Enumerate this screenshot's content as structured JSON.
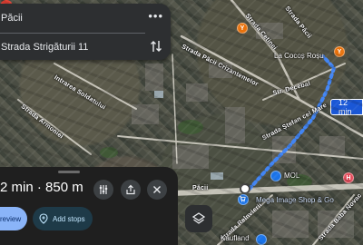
{
  "search": {
    "origin": "Păcii",
    "destination": "Strada Strigăturii 11",
    "more_icon": "more-horizontal-icon",
    "swap_icon": "swap-vertical-icon"
  },
  "map": {
    "streets": [
      "Strada Cetinei",
      "Strada Păcii",
      "Strada Păcii Crizantemelor",
      "Str. Decebal",
      "Strada Ștefan cel Mare",
      "Intrarea Soldatului",
      "Strada Armoniei",
      "Păcii",
      "Strada Baba Novac",
      "Strada Reînvierii"
    ],
    "places": {
      "destination": "La Cocoș Roșu",
      "mol": "MOL",
      "mega_image": "Mega Image Shop & Go",
      "kaufland": "Kaufland"
    },
    "route_time_badge": "12 min",
    "poi_glyphs": {
      "food": "Y",
      "health": "H"
    },
    "route_color": "#4285f4"
  },
  "sheet": {
    "trip_info": "2 min · 850 m",
    "preview_label": "review",
    "add_stops_label": "Add stops"
  },
  "colors": {
    "accent": "#8ab4f8",
    "route": "#4285f4",
    "badge": "#1a57d6",
    "pin": "#ea4335"
  }
}
